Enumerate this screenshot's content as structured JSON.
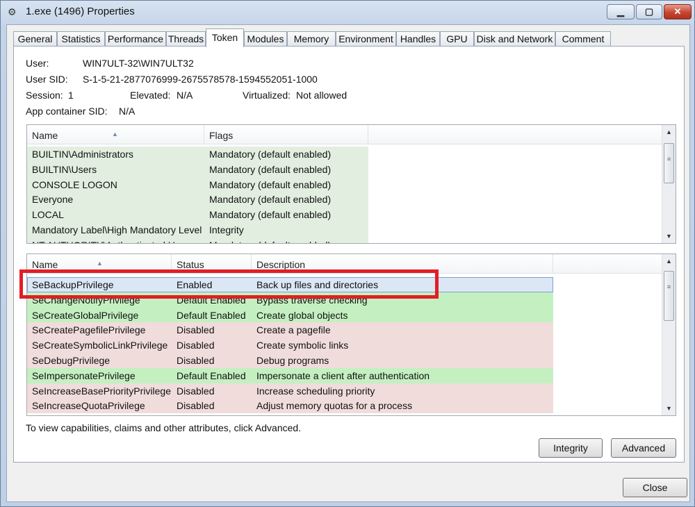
{
  "window": {
    "title": "1.exe (1496) Properties",
    "icon": "gear-icon"
  },
  "tabs": [
    "General",
    "Statistics",
    "Performance",
    "Threads",
    "Token",
    "Modules",
    "Memory",
    "Environment",
    "Handles",
    "GPU",
    "Disk and Network",
    "Comment"
  ],
  "active_tab": "Token",
  "info": {
    "user_label": "User:",
    "user_value": "WIN7ULT-32\\WIN7ULT32",
    "sid_label": "User SID:",
    "sid_value": "S-1-5-21-2877076999-2675578578-1594552051-1000",
    "session_label": "Session:",
    "session_value": "1",
    "elevated_label": "Elevated:",
    "elevated_value": "N/A",
    "virtualized_label": "Virtualized:",
    "virtualized_value": "Not allowed",
    "appcontainer_label": "App container SID:",
    "appcontainer_value": "N/A"
  },
  "groups": {
    "columns": [
      "Name",
      "Flags"
    ],
    "rows": [
      {
        "name": "BUILTIN\\Administrators",
        "flags": "Mandatory (default enabled)"
      },
      {
        "name": "BUILTIN\\Users",
        "flags": "Mandatory (default enabled)"
      },
      {
        "name": "CONSOLE LOGON",
        "flags": "Mandatory (default enabled)"
      },
      {
        "name": "Everyone",
        "flags": "Mandatory (default enabled)"
      },
      {
        "name": "LOCAL",
        "flags": "Mandatory (default enabled)"
      },
      {
        "name": "Mandatory Label\\High Mandatory Level",
        "flags": "Integrity"
      },
      {
        "name": "NT AUTHORITY\\Authenticated Users",
        "flags": "Mandatory (default enabled)"
      }
    ]
  },
  "privileges": {
    "columns": [
      "Name",
      "Status",
      "Description"
    ],
    "rows": [
      {
        "name": "SeBackupPrivilege",
        "status": "Enabled",
        "description": "Back up files and directories",
        "kind": "selected"
      },
      {
        "name": "SeChangeNotifyPrivilege",
        "status": "Default Enabled",
        "description": "Bypass traverse checking",
        "kind": "enabled"
      },
      {
        "name": "SeCreateGlobalPrivilege",
        "status": "Default Enabled",
        "description": "Create global objects",
        "kind": "enabled"
      },
      {
        "name": "SeCreatePagefilePrivilege",
        "status": "Disabled",
        "description": "Create a pagefile",
        "kind": "disabled"
      },
      {
        "name": "SeCreateSymbolicLinkPrivilege",
        "status": "Disabled",
        "description": "Create symbolic links",
        "kind": "disabled"
      },
      {
        "name": "SeDebugPrivilege",
        "status": "Disabled",
        "description": "Debug programs",
        "kind": "disabled"
      },
      {
        "name": "SeImpersonatePrivilege",
        "status": "Default Enabled",
        "description": "Impersonate a client after authentication",
        "kind": "enabled"
      },
      {
        "name": "SeIncreaseBasePriorityPrivilege",
        "status": "Disabled",
        "description": "Increase scheduling priority",
        "kind": "disabled"
      },
      {
        "name": "SeIncreaseQuotaPrivilege",
        "status": "Disabled",
        "description": "Adjust memory quotas for a process",
        "kind": "disabled"
      }
    ]
  },
  "hint_text": "To view capabilities, claims and other attributes, click Advanced.",
  "buttons": {
    "integrity": "Integrity",
    "advanced": "Advanced",
    "close": "Close"
  },
  "colors": {
    "group_bg": "#e2efe0",
    "enabled_bg": "#c4f0c1",
    "disabled_bg": "#f1dcdc",
    "selected_bg": "#dbe7f5",
    "highlight_box": "#e31d25"
  }
}
